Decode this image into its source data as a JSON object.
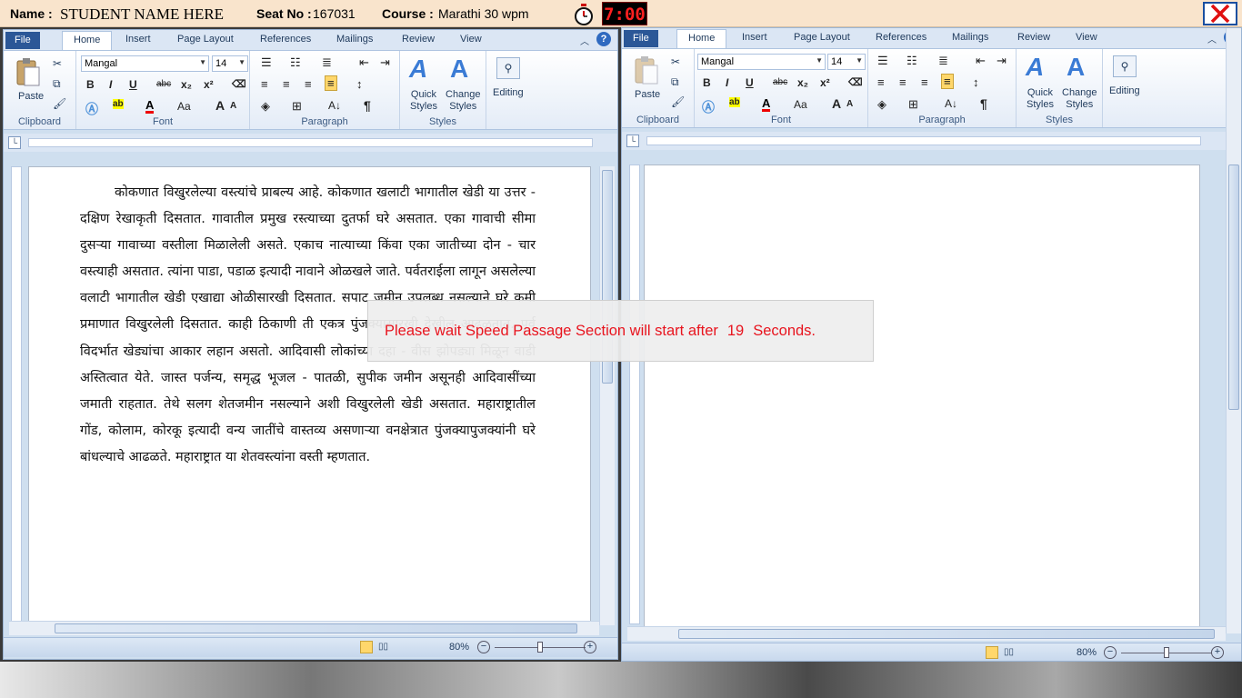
{
  "header": {
    "name_label": "Name :",
    "name_value": "STUDENT NAME HERE",
    "seat_label": "Seat No :",
    "seat_value": "167031",
    "course_label": "Course :",
    "course_value": "Marathi 30 wpm",
    "timer": "7:00",
    "timer_color": "#ff2020",
    "close_icon": "red-x-icon"
  },
  "ribbon": {
    "tabs": [
      "File",
      "Home",
      "Insert",
      "Page Layout",
      "References",
      "Mailings",
      "Review",
      "View"
    ],
    "font_name": "Mangal",
    "font_size": "14",
    "groups": {
      "clipboard": "Clipboard",
      "font": "Font",
      "paragraph": "Paragraph",
      "styles": "Styles"
    },
    "paste_label": "Paste",
    "quick_styles_1": "Quick",
    "quick_styles_2": "Styles",
    "change_styles_1": "Change",
    "change_styles_2": "Styles",
    "editing_label": "Editing",
    "font_buttons": [
      "B",
      "I",
      "U",
      "abc",
      "x₂",
      "x²"
    ],
    "size_buttons": [
      "A",
      "A",
      "Aa"
    ],
    "pilcrow": "¶"
  },
  "status": {
    "zoom": "80%",
    "zoom_fraction": 0.5
  },
  "passage": "कोकणात विखुरलेल्या वस्त्यांचे प्राबल्य आहे. कोकणात खलाटी भागातील खेडी या उत्तर - दक्षिण रेखाकृती दिसतात. गावातील प्रमुख रस्त्याच्या दुतर्फा घरे असतात. एका गावाची सीमा दुसऱ्या गावाच्या वस्तीला मिळालेली असते. एकाच नात्याच्या किंवा एका जातीच्या दोन - चार वस्त्याही असतात. त्यांना पाडा, पडाळ इत्यादी नावाने ओळखले जाते. पर्वतराईला लागून असलेल्या वलाटी भागातील खेडी एखाद्या ओळीसारखी दिसतात. सपाट जमीन उपलब्ध नसल्याने घरे कमी प्रमाणात विखुरलेली दिसतात. काही ठिकाणी ती एकत्र पुंजक्यासारखी देखील आढळतात. पूर्व विदर्भात खेड्यांचा आकार लहान असतो. आदिवासी लोकांच्या दहा - वीस झोपड्या मिळून वाडी अस्तित्वात येते. जास्त पर्जन्य, समृद्ध भूजल - पातळी, सुपीक जमीन असूनही आदिवासींच्या जमाती राहतात. तेथे सलग शेतजमीन नसल्याने अशी विखुरलेली खेडी असतात. महाराष्ट्रातील गोंड, कोलाम, कोरकू इत्यादी वन्य जातींचे वास्तव्य असणाऱ्या वनक्षेत्रात पुंजक्यापुजक्यांनी घरे बांधल्याचे आढळते. महाराष्ट्रात या शेतवस्त्यांना वस्ती म्हणतात.",
  "overlay": {
    "prefix": "Please wait Speed Passage Section will start after",
    "seconds": "19",
    "suffix": "Seconds.",
    "color": "#e8141e"
  }
}
